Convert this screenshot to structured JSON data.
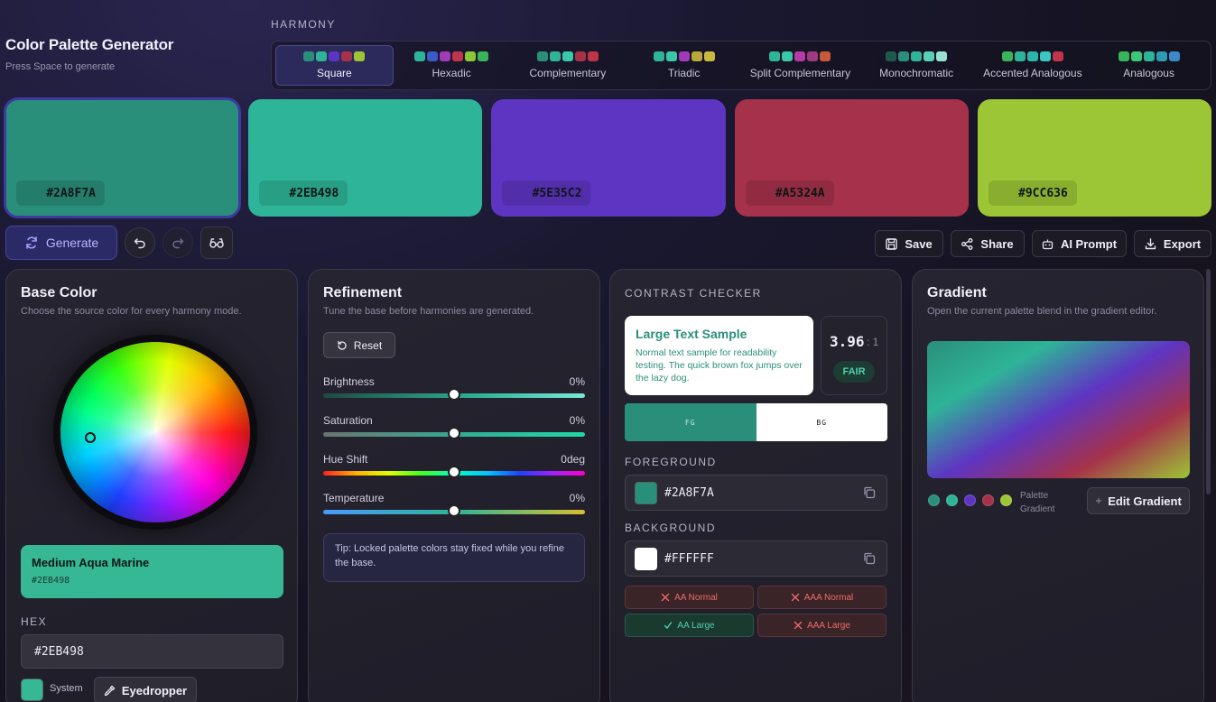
{
  "header": {
    "title": "Color Palette Generator",
    "subtitle": "Press Space to generate"
  },
  "harmony": {
    "label": "HARMONY",
    "tabs": [
      {
        "label": "Square",
        "active": true,
        "dots": [
          "#2a8f7a",
          "#2eb498",
          "#5e35c2",
          "#a5324a",
          "#9cc636"
        ]
      },
      {
        "label": "Hexadic",
        "active": false,
        "dots": [
          "#2eb498",
          "#3a5ac8",
          "#a03ab8",
          "#c0344c",
          "#8ac836",
          "#3ab45a"
        ]
      },
      {
        "label": "Complementary",
        "active": false,
        "dots": [
          "#2a8f7a",
          "#2eb498",
          "#3ac8a8",
          "#a5324a",
          "#c03448"
        ]
      },
      {
        "label": "Triadic",
        "active": false,
        "dots": [
          "#2eb498",
          "#3ac8a8",
          "#a03ab8",
          "#b8a838",
          "#c8b840"
        ]
      },
      {
        "label": "Split Complementary",
        "active": false,
        "dots": [
          "#2eb498",
          "#3ac8a8",
          "#b83aa8",
          "#a03a80",
          "#c85a3a"
        ]
      },
      {
        "label": "Monochromatic",
        "active": false,
        "dots": [
          "#1e5a4c",
          "#2a8f7a",
          "#2eb498",
          "#5ad0b4",
          "#9ae0d0"
        ]
      },
      {
        "label": "Accented Analogous",
        "active": false,
        "dots": [
          "#3ab45a",
          "#2eb498",
          "#2eb4a8",
          "#3ac8c0",
          "#c0344c"
        ]
      },
      {
        "label": "Analogous",
        "active": false,
        "dots": [
          "#3ab45a",
          "#3ac878",
          "#2eb498",
          "#2e9ab4",
          "#3a8ac8"
        ]
      }
    ]
  },
  "palette": [
    {
      "hex": "#2A8F7A",
      "color": "#2a8f7a",
      "selected": true
    },
    {
      "hex": "#2EB498",
      "color": "#2eb498",
      "selected": false
    },
    {
      "hex": "#5E35C2",
      "color": "#5e35c2",
      "selected": false
    },
    {
      "hex": "#A5324A",
      "color": "#a5324a",
      "selected": false
    },
    {
      "hex": "#9CC636",
      "color": "#9cc636",
      "selected": false
    }
  ],
  "toolbar": {
    "generate_label": "Generate",
    "save_label": "Save",
    "share_label": "Share",
    "ai_prompt_label": "AI Prompt",
    "export_label": "Export"
  },
  "base_color": {
    "title": "Base Color",
    "subtitle": "Choose the source color for every harmony mode.",
    "color_name": "Medium Aqua Marine",
    "color_name_hex": "#2EB498",
    "hex_label": "HEX",
    "hex_value": "#2EB498",
    "system_label": "System",
    "eyedropper_label": "Eyedropper"
  },
  "refinement": {
    "title": "Refinement",
    "subtitle": "Tune the base before harmonies are generated.",
    "reset_label": "Reset",
    "sliders": [
      {
        "label": "Brightness",
        "value": "0%",
        "position": 0.5
      },
      {
        "label": "Saturation",
        "value": "0%",
        "position": 0.5
      },
      {
        "label": "Hue Shift",
        "value": "0deg",
        "position": 0.5
      },
      {
        "label": "Temperature",
        "value": "0%",
        "position": 0.5
      }
    ],
    "tip": "Tip: Locked palette colors stay fixed while you refine the base."
  },
  "contrast": {
    "title": "CONTRAST CHECKER",
    "sample_title": "Large Text Sample",
    "sample_body": "Normal text sample for readability testing. The quick brown fox jumps over the lazy dog.",
    "ratio": "3.96",
    "ratio_suffix": ": 1",
    "rating": "FAIR",
    "fg_short": "FG",
    "bg_short": "BG",
    "foreground_label": "FOREGROUND",
    "foreground_hex": "#2A8F7A",
    "background_label": "BACKGROUND",
    "background_hex": "#FFFFFF",
    "checks": [
      {
        "label": "AA Normal",
        "pass": false
      },
      {
        "label": "AAA Normal",
        "pass": false
      },
      {
        "label": "AA Large",
        "pass": true
      },
      {
        "label": "AAA Large",
        "pass": false
      }
    ]
  },
  "gradient": {
    "title": "Gradient",
    "subtitle": "Open the current palette blend in the gradient editor.",
    "palette_label_1": "Palette",
    "palette_label_2": "Gradient",
    "edit_label": "Edit Gradient"
  }
}
